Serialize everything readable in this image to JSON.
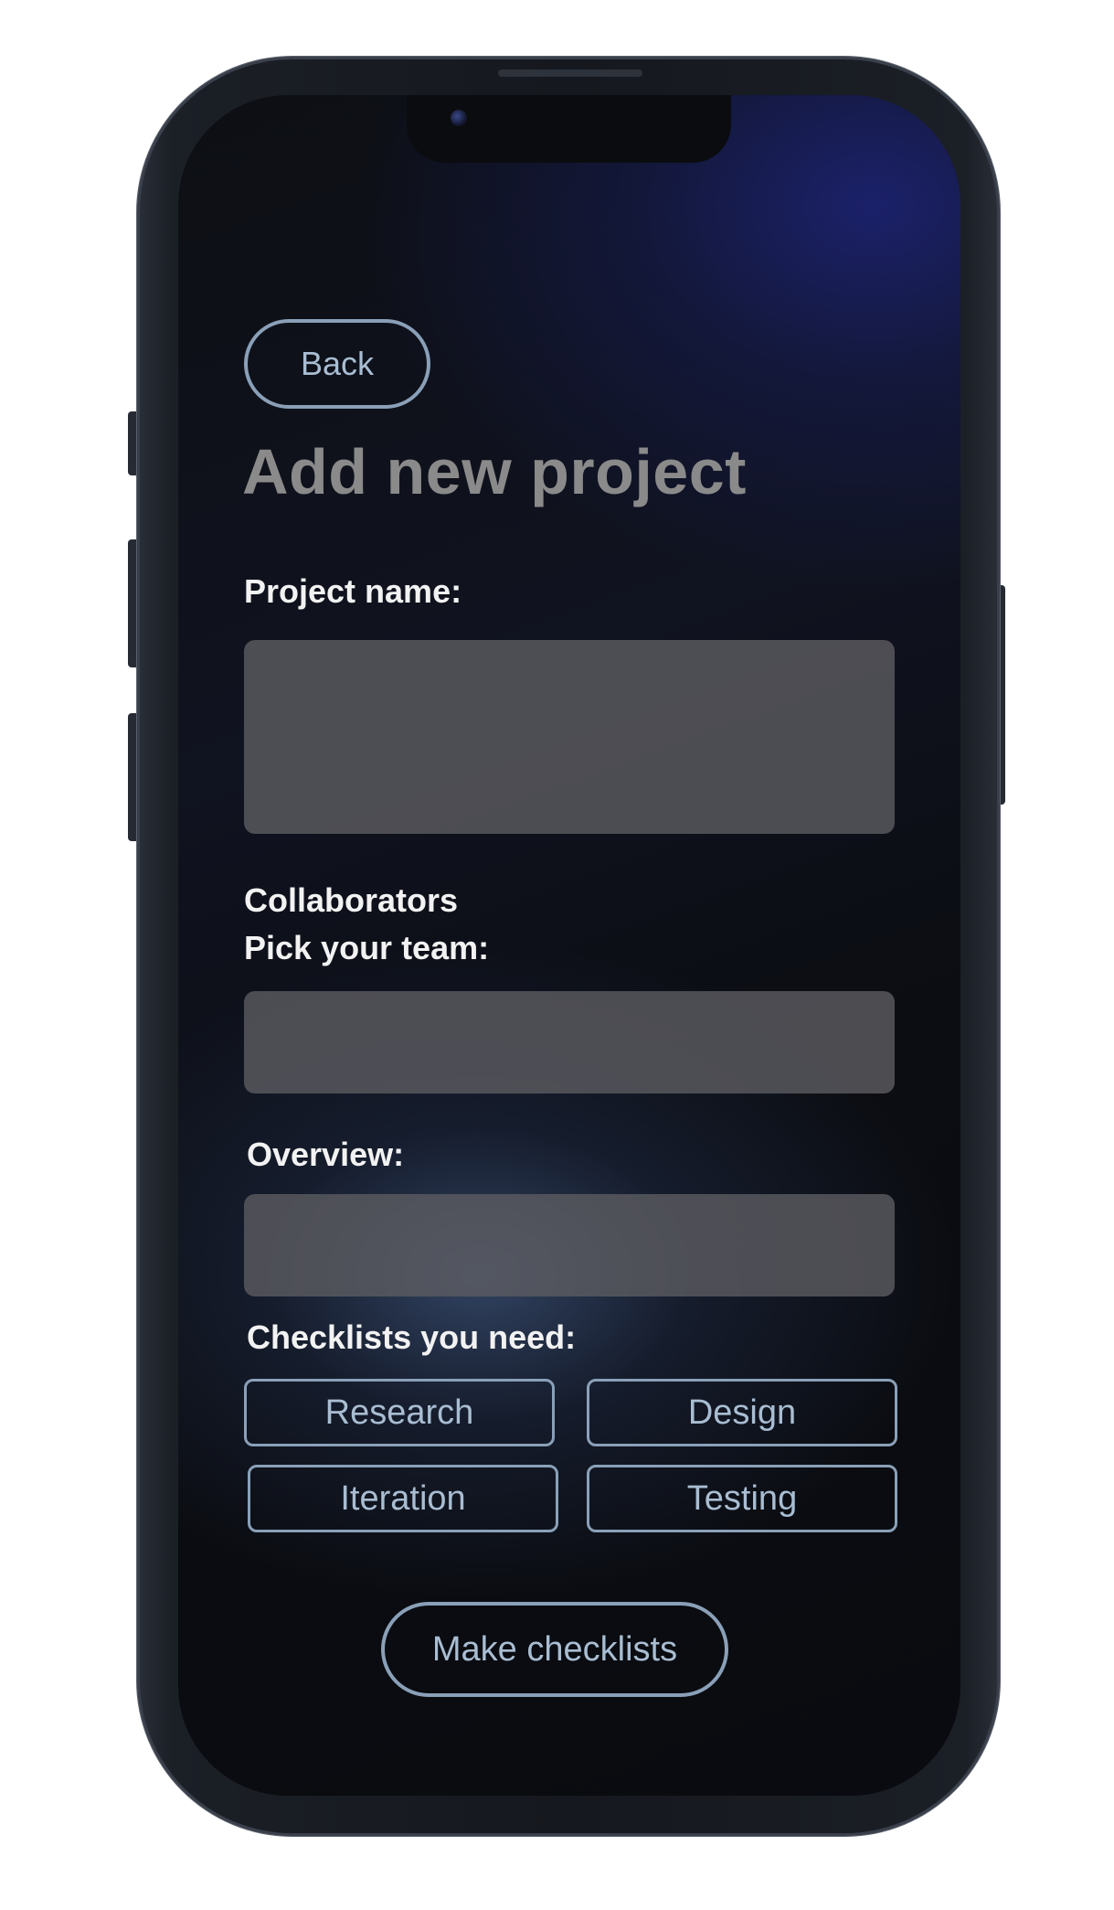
{
  "screen": {
    "back_label": "Back",
    "title": "Add new project"
  },
  "form": {
    "project_name_label": "Project name:",
    "project_name_value": "",
    "collaborators_label": "Collaborators",
    "pick_team_label": "Pick your team:",
    "team_value": "",
    "overview_label": "Overview:",
    "overview_value": "",
    "checklists_label": "Checklists you need:",
    "checklists": [
      {
        "label": "Research"
      },
      {
        "label": "Design"
      },
      {
        "label": "Iteration"
      },
      {
        "label": "Testing"
      }
    ],
    "submit_label": "Make checklists"
  },
  "colors": {
    "accent_border": "#8aa0b8",
    "accent_text": "#a9bdd2",
    "title_text": "#8a8a8a",
    "label_text": "#f2f2f2",
    "input_fill": "#5c5d62"
  }
}
